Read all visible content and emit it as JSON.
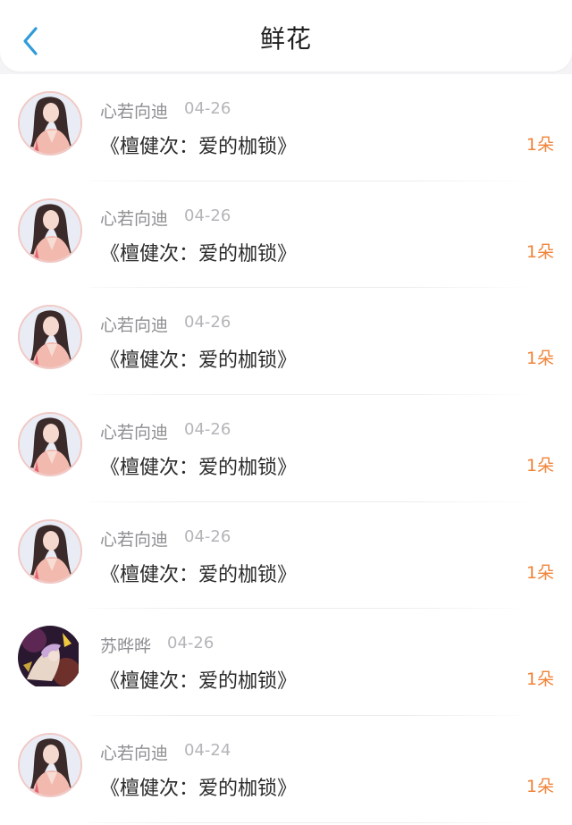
{
  "header": {
    "title": "鲜花",
    "back_icon": "chevron-left-icon",
    "accent": "#2f9bd8"
  },
  "colors": {
    "count": "#f0843a",
    "name": "#8f8f93",
    "date": "#b5b5b9"
  },
  "gifts": [
    {
      "user": "心若向迪",
      "date": "04-26",
      "book": "《檀健次：爱的枷锁》",
      "amount": "1朵",
      "avatar": "avatar-girl"
    },
    {
      "user": "心若向迪",
      "date": "04-26",
      "book": "《檀健次：爱的枷锁》",
      "amount": "1朵",
      "avatar": "avatar-girl"
    },
    {
      "user": "心若向迪",
      "date": "04-26",
      "book": "《檀健次：爱的枷锁》",
      "amount": "1朵",
      "avatar": "avatar-girl"
    },
    {
      "user": "心若向迪",
      "date": "04-26",
      "book": "《檀健次：爱的枷锁》",
      "amount": "1朵",
      "avatar": "avatar-girl"
    },
    {
      "user": "心若向迪",
      "date": "04-26",
      "book": "《檀健次：爱的枷锁》",
      "amount": "1朵",
      "avatar": "avatar-girl"
    },
    {
      "user": "苏晔晔",
      "date": "04-26",
      "book": "《檀健次：爱的枷锁》",
      "amount": "1朵",
      "avatar": "avatar-anime"
    },
    {
      "user": "心若向迪",
      "date": "04-24",
      "book": "《檀健次：爱的枷锁》",
      "amount": "1朵",
      "avatar": "avatar-girl"
    }
  ]
}
